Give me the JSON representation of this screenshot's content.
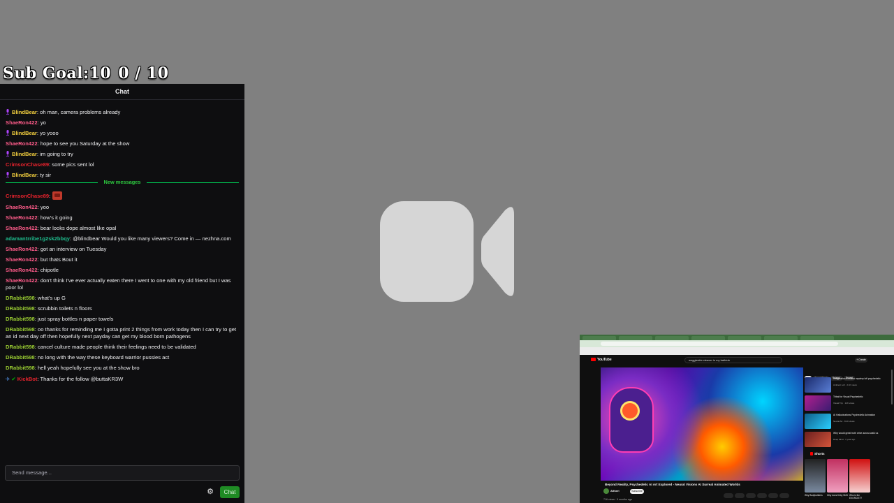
{
  "subgoal": {
    "label": "Sub Goal:10",
    "count": "0 / 10"
  },
  "chat": {
    "title": "Chat",
    "messages": [
      {
        "user": "BlindBear",
        "color": "#f4d03f",
        "badge": "mic",
        "text": ": oh man, camera problems already"
      },
      {
        "user": "ShaeRon422",
        "color": "#ff5c8a",
        "badge": "",
        "text": ": yo"
      },
      {
        "user": "BlindBear",
        "color": "#f4d03f",
        "badge": "mic",
        "text": ": yo yooo"
      },
      {
        "user": "ShaeRon422",
        "color": "#ff5c8a",
        "badge": "",
        "text": ": hope to see you Saturday at the show"
      },
      {
        "user": "BlindBear",
        "color": "#f4d03f",
        "badge": "mic",
        "text": ": im going to try"
      },
      {
        "user": "CrimsonChase89",
        "color": "#e8232d",
        "badge": "",
        "text": ": some pics sent lol"
      },
      {
        "user": "BlindBear",
        "color": "#f4d03f",
        "badge": "mic",
        "text": ": ty sir"
      },
      {
        "user": "CrimsonChase89",
        "color": "#e8232d",
        "badge": "",
        "text": ":",
        "emote": "emote"
      },
      {
        "user": "ShaeRon422",
        "color": "#ff5c8a",
        "badge": "",
        "text": ": yoo"
      },
      {
        "user": "ShaeRon422",
        "color": "#ff5c8a",
        "badge": "",
        "text": ": how's it going"
      },
      {
        "user": "ShaeRon422",
        "color": "#ff5c8a",
        "badge": "",
        "text": ": bear looks dope almost like opal"
      },
      {
        "user": "adamantrribe1g2sk2bbqy",
        "color": "#1fbf8f",
        "badge": "",
        "text": ": @blindbear Would you like many viewers? Come in — nezhna.com"
      },
      {
        "user": "ShaeRon422",
        "color": "#ff5c8a",
        "badge": "",
        "text": ": got an interview on Tuesday"
      },
      {
        "user": "ShaeRon422",
        "color": "#ff5c8a",
        "badge": "",
        "text": ": but thats Bout it"
      },
      {
        "user": "ShaeRon422",
        "color": "#ff5c8a",
        "badge": "",
        "text": ": chipotle"
      },
      {
        "user": "ShaeRon422",
        "color": "#ff5c8a",
        "badge": "",
        "text": ": don't think I've ever actually eaten there I went to one with my old friend but I was poor lol"
      },
      {
        "user": "DRabbit598",
        "color": "#9acd32",
        "badge": "",
        "text": ": what's up G"
      },
      {
        "user": "DRabbit598",
        "color": "#9acd32",
        "badge": "",
        "text": ": scrubbin toilets n floors"
      },
      {
        "user": "DRabbit598",
        "color": "#9acd32",
        "badge": "",
        "text": ": just spray bottles n paper towels"
      },
      {
        "user": "DRabbit598",
        "color": "#9acd32",
        "badge": "",
        "text": ": oo thanks for reminding me I gotta print 2 things from work today then I can try to get an id next day off then hopefully next payday can get my blood born pathogens"
      },
      {
        "user": "DRabbit598",
        "color": "#9acd32",
        "badge": "",
        "text": ": cancel culture made people think their feelings need to be validated"
      },
      {
        "user": "DRabbit598",
        "color": "#9acd32",
        "badge": "",
        "text": ": no long with the way these keyboard warrior pussies act"
      },
      {
        "user": "DRabbit598",
        "color": "#9acd32",
        "badge": "",
        "text": ": hell yeah hopefully see you at the show bro"
      },
      {
        "user": "KickBot",
        "color": "#e8232d",
        "badge": "bot",
        "text": ": Thanks for the follow @buttaKR3W"
      }
    ],
    "new_messages_label": "New messages",
    "input_placeholder": "Send message...",
    "send_label": "Chat"
  },
  "camera_icon": "video-camera-off-placeholder",
  "youtube_window": {
    "brand": "YouTube",
    "search_query": "wegglesbix cleaver in my bathtub",
    "create_label": "+ Create",
    "video_title": "Beyond Reality, Psychedelic AI Art Explored - Neural Visions AI Surreal Animated Worlds",
    "channel": "Aitheri",
    "subscribe_label": "Subscribe",
    "views_line": "716 views · 9 months ago",
    "chips": [
      "All",
      "From Aitheri",
      "Related",
      "Recent"
    ],
    "recommendations": [
      {
        "title": "Imagination a million mystery lofi psychedelic",
        "meta": "Ambient Lofi · 2.1K views"
      },
      {
        "title": "Tribal for Visual Psychedelic",
        "meta": "Visual Trip · 12K views"
      },
      {
        "title": "AI Hallucinations Psychedelic Animation",
        "meta": "Neural Art · 8.4K views"
      },
      {
        "title": "Why would great truth drive aurora walk us",
        "meta": "Deep Mind · 1 year ago"
      }
    ],
    "shorts_label": "Shorts",
    "shorts": [
      {
        "caption": "Why Bodybuilders"
      },
      {
        "caption": "Why does Kirby Shift"
      },
      {
        "caption": "Who is the EXORCIST?"
      }
    ]
  }
}
